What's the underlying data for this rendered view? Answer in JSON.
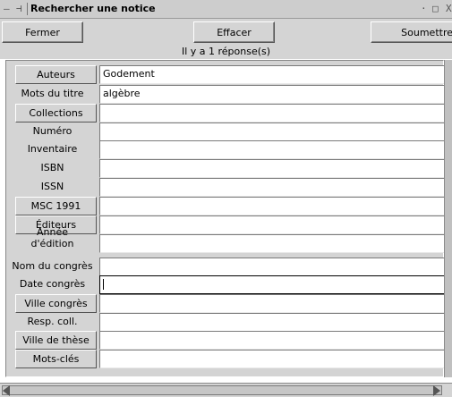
{
  "window": {
    "title": "Rechercher une notice",
    "controls": {
      "menu": "—",
      "pin": "⊣",
      "minimize": "·",
      "maximize": "□",
      "close": "X"
    }
  },
  "toolbar": {
    "close_label": "Fermer",
    "clear_label": "Effacer",
    "submit_label": "Soumettre"
  },
  "status": {
    "text": "Il y a 1 réponse(s)"
  },
  "fields": [
    {
      "label": "Auteurs",
      "button": true,
      "value": "Godement"
    },
    {
      "label": "Mots du titre",
      "button": false,
      "value": "algèbre"
    },
    {
      "label": "Collections",
      "button": true,
      "value": ""
    },
    {
      "label": "Numéro",
      "button": false,
      "value": ""
    },
    {
      "label": "Inventaire",
      "button": false,
      "value": ""
    },
    {
      "label": "ISBN",
      "button": false,
      "value": ""
    },
    {
      "label": "ISSN",
      "button": false,
      "value": ""
    },
    {
      "label": "MSC 1991",
      "button": true,
      "value": ""
    },
    {
      "label": "Éditeurs",
      "button": true,
      "value": ""
    },
    {
      "label": "Année\nd'édition",
      "button": false,
      "value": ""
    },
    {
      "label": "Nom du congrès",
      "button": false,
      "value": ""
    },
    {
      "label": "Date congrès",
      "button": false,
      "value": "",
      "focused": true
    },
    {
      "label": "Ville congrès",
      "button": true,
      "value": ""
    },
    {
      "label": "Resp. coll.",
      "button": false,
      "value": ""
    },
    {
      "label": "Ville de thèse",
      "button": true,
      "value": ""
    },
    {
      "label": "Mots-clés",
      "button": true,
      "value": ""
    }
  ]
}
